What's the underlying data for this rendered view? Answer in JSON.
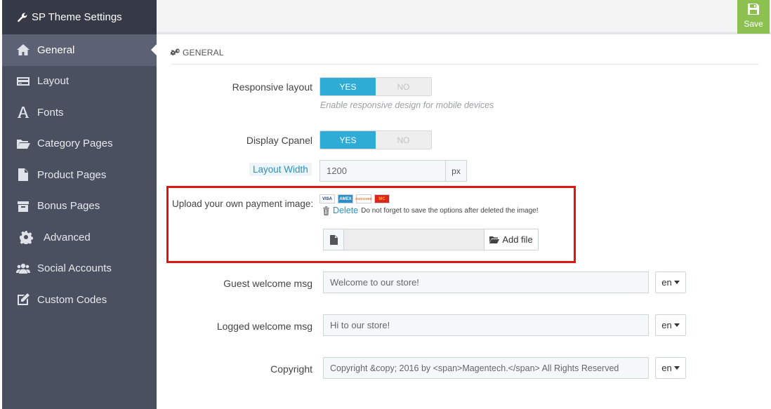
{
  "sidebar": {
    "title": "SP Theme Settings",
    "items": [
      {
        "label": "General",
        "icon": "home-icon",
        "active": true
      },
      {
        "label": "Layout",
        "icon": "credit-card-icon"
      },
      {
        "label": "Fonts",
        "icon": "font-icon"
      },
      {
        "label": "Category Pages",
        "icon": "folder-open-icon"
      },
      {
        "label": "Product Pages",
        "icon": "file-text-icon"
      },
      {
        "label": "Bonus Pages",
        "icon": "archive-icon"
      },
      {
        "label": "Advanced",
        "icon": "gear-icon"
      },
      {
        "label": "Social Accounts",
        "icon": "users-icon"
      },
      {
        "label": "Custom Codes",
        "icon": "pencil-square-icon"
      }
    ]
  },
  "toolbar": {
    "save_label": "Save"
  },
  "section": {
    "title": "GENERAL"
  },
  "form": {
    "responsive": {
      "label": "Responsive layout",
      "yes": "YES",
      "no": "NO",
      "help": "Enable responsive design for mobile devices"
    },
    "cpanel": {
      "label": "Display Cpanel",
      "yes": "YES",
      "no": "NO"
    },
    "layout_width": {
      "label": "Layout Width",
      "value": "1200",
      "unit": "px"
    },
    "payment": {
      "label": "Upload your own payment image:",
      "cards": [
        "VISA",
        "AMEX",
        "DISCOVER",
        "MC"
      ],
      "delete_label": "Delete",
      "delete_note": "Do not forget to save the options after deleted the image!",
      "add_file_label": "Add file"
    },
    "guest_msg": {
      "label": "Guest welcome msg",
      "value": "Welcome to our store!",
      "lang": "en"
    },
    "logged_msg": {
      "label": "Logged welcome msg",
      "value": "Hi to our store!",
      "lang": "en"
    },
    "copyright": {
      "label": "Copyright",
      "value": "Copyright &copy; 2016 by <span>Magentech.</span> All Rights Reserved",
      "lang": "en"
    }
  },
  "colors": {
    "accent": "#2eacd6",
    "save": "#8cc152",
    "sidebar": "#4a5060",
    "highlight_box": "#e31313"
  }
}
